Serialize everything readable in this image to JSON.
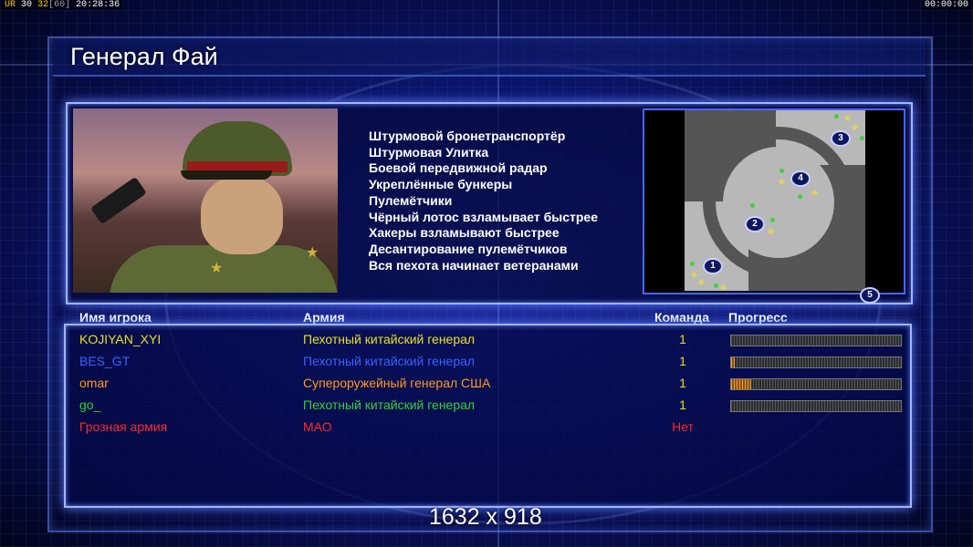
{
  "hud": {
    "ur_label": "UR",
    "fps": "30",
    "fps_target": "32",
    "fps_cap": "[60]",
    "clock": "20:28:36",
    "timer": "00:00:00"
  },
  "general": {
    "title": "Генерал Фай",
    "perks": [
      "Штурмовой бронетранспортёр",
      "Штурмовая Улитка",
      "Боевой передвижной радар",
      "Укреплённые бункеры",
      "Пулемётчики",
      "Чёрный лотос взламывает быстрее",
      "Хакеры взламывают быстрее",
      "Десантирование пулемётчиков",
      "Вся пехота начинает ветеранами"
    ]
  },
  "minimap": {
    "start_positions": [
      "1",
      "2",
      "3",
      "4",
      "5"
    ]
  },
  "table": {
    "headers": {
      "player": "Имя игрока",
      "army": "Армия",
      "team": "Команда",
      "progress": "Прогресс"
    },
    "rows": [
      {
        "name": "KOJIYAN_XYI",
        "army": "Пехотный китайский генерал",
        "team": "1",
        "progress": 0,
        "color": "#e8e020"
      },
      {
        "name": "BES_GT",
        "army": "Пехотный китайский генерал",
        "team": "1",
        "progress": 0.02,
        "color": "#3a62ff"
      },
      {
        "name": "omar",
        "army": "Супероружейный генерал США",
        "team": "1",
        "progress": 0.12,
        "color": "#ff9a1a"
      },
      {
        "name": "go_",
        "army": "Пехотный китайский генерал",
        "team": "1",
        "progress": 0,
        "color": "#35d235"
      },
      {
        "name": "Грозная армия",
        "army": "МАО",
        "team": "Нет",
        "progress": null,
        "color": "#ff2a2a"
      }
    ]
  },
  "footer": {
    "resolution": "1632 x 918"
  }
}
